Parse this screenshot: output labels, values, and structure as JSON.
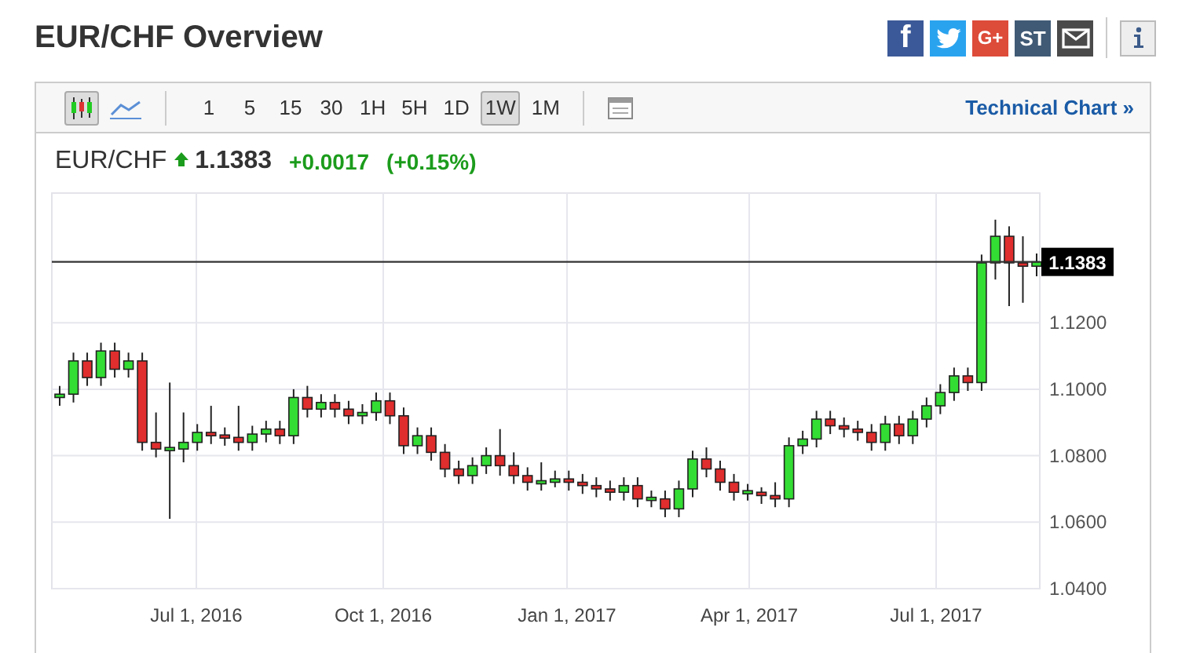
{
  "page": {
    "title": "EUR/CHF Overview"
  },
  "share_buttons": [
    {
      "kind": "facebook",
      "text": "f"
    },
    {
      "kind": "twitter"
    },
    {
      "kind": "googleplus",
      "text": "G+"
    },
    {
      "kind": "stocktwits",
      "text": "ST"
    },
    {
      "kind": "email"
    }
  ],
  "toolbar": {
    "chart_types": [
      {
        "kind": "candlestick",
        "selected": true
      },
      {
        "kind": "line",
        "selected": false
      }
    ],
    "intervals": [
      {
        "label": "1",
        "selected": false
      },
      {
        "label": "5",
        "selected": false
      },
      {
        "label": "15",
        "selected": false
      },
      {
        "label": "30",
        "selected": false
      },
      {
        "label": "1H",
        "selected": false
      },
      {
        "label": "5H",
        "selected": false
      },
      {
        "label": "1D",
        "selected": false
      },
      {
        "label": "1W",
        "selected": true
      },
      {
        "label": "1M",
        "selected": false
      }
    ],
    "technical_link": "Technical Chart »"
  },
  "quote": {
    "symbol": "EUR/CHF",
    "trend_up": true,
    "price": "1.1383",
    "change": "+0.0017",
    "change_percent": "(+0.15%)"
  },
  "chart": {
    "x_labels": [
      "Jul 1, 2016",
      "Oct 1, 2016",
      "Jan 1, 2017",
      "Apr 1, 2017",
      "Jul 1, 2017"
    ],
    "chart_data": {
      "type": "candlestick",
      "ylim": [
        1.04,
        1.159
      ],
      "grid": true,
      "ref_lines": [
        {
          "axis": "y",
          "value": 1.1383,
          "label": "1.1383"
        }
      ],
      "yticks": [
        {
          "value": 1.12,
          "label": "1.1200"
        },
        {
          "value": 1.1,
          "label": "1.1000"
        },
        {
          "value": 1.08,
          "label": "1.0800"
        },
        {
          "value": 1.06,
          "label": "1.0600"
        },
        {
          "value": 1.04,
          "label": "1.0400"
        }
      ],
      "ohlc": [
        [
          1.0975,
          1.101,
          1.095,
          1.0985
        ],
        [
          1.0985,
          1.111,
          1.096,
          1.1085
        ],
        [
          1.1085,
          1.111,
          1.101,
          1.1035
        ],
        [
          1.1035,
          1.114,
          1.101,
          1.1115
        ],
        [
          1.1115,
          1.114,
          1.1035,
          1.106
        ],
        [
          1.106,
          1.111,
          1.1035,
          1.1085
        ],
        [
          1.1085,
          1.111,
          1.0815,
          1.084
        ],
        [
          1.084,
          1.093,
          1.0795,
          1.082
        ],
        [
          1.082,
          1.102,
          1.061,
          1.082
        ],
        [
          1.082,
          1.093,
          1.078,
          1.084
        ],
        [
          1.084,
          1.0895,
          1.0815,
          1.087
        ],
        [
          1.087,
          1.095,
          1.0835,
          1.086
        ],
        [
          1.086,
          1.0885,
          1.083,
          1.0855
        ],
        [
          1.0855,
          1.095,
          1.0815,
          1.084
        ],
        [
          1.084,
          1.089,
          1.0815,
          1.0865
        ],
        [
          1.0865,
          1.0905,
          1.084,
          1.088
        ],
        [
          1.088,
          1.0905,
          1.0835,
          1.086
        ],
        [
          1.086,
          1.1,
          1.0835,
          1.0975
        ],
        [
          1.0975,
          1.101,
          1.0915,
          1.094
        ],
        [
          1.094,
          1.0985,
          1.0915,
          1.096
        ],
        [
          1.096,
          1.0985,
          1.0915,
          1.094
        ],
        [
          1.094,
          1.0965,
          1.0895,
          1.092
        ],
        [
          1.092,
          1.0955,
          1.0895,
          1.093
        ],
        [
          1.093,
          1.099,
          1.0905,
          1.0965
        ],
        [
          1.0965,
          1.099,
          1.0895,
          1.092
        ],
        [
          1.092,
          1.0945,
          1.0805,
          1.083
        ],
        [
          1.083,
          1.0885,
          1.0805,
          1.086
        ],
        [
          1.086,
          1.0885,
          1.0785,
          1.081
        ],
        [
          1.081,
          1.0835,
          1.0735,
          1.076
        ],
        [
          1.076,
          1.0785,
          1.0715,
          1.074
        ],
        [
          1.074,
          1.0795,
          1.0715,
          1.077
        ],
        [
          1.077,
          1.0825,
          1.0745,
          1.08
        ],
        [
          1.08,
          1.088,
          1.074,
          1.077
        ],
        [
          1.077,
          1.081,
          1.0715,
          1.074
        ],
        [
          1.074,
          1.0765,
          1.0695,
          1.072
        ],
        [
          1.072,
          1.078,
          1.0695,
          1.072
        ],
        [
          1.072,
          1.0755,
          1.0705,
          1.073
        ],
        [
          1.073,
          1.0755,
          1.0695,
          1.072
        ],
        [
          1.072,
          1.0745,
          1.0685,
          1.071
        ],
        [
          1.071,
          1.0735,
          1.0675,
          1.07
        ],
        [
          1.07,
          1.0725,
          1.0665,
          1.069
        ],
        [
          1.069,
          1.0735,
          1.0665,
          1.071
        ],
        [
          1.071,
          1.0735,
          1.0645,
          1.067
        ],
        [
          1.067,
          1.0695,
          1.0645,
          1.067
        ],
        [
          1.067,
          1.0695,
          1.0615,
          1.064
        ],
        [
          1.064,
          1.0725,
          1.0615,
          1.07
        ],
        [
          1.07,
          1.0815,
          1.0675,
          1.079
        ],
        [
          1.079,
          1.0825,
          1.0735,
          1.076
        ],
        [
          1.076,
          1.0785,
          1.0695,
          1.072
        ],
        [
          1.072,
          1.0745,
          1.0665,
          1.069
        ],
        [
          1.069,
          1.0715,
          1.0665,
          1.069
        ],
        [
          1.069,
          1.0705,
          1.0655,
          1.068
        ],
        [
          1.068,
          1.072,
          1.0645,
          1.067
        ],
        [
          1.067,
          1.0855,
          1.0645,
          1.083
        ],
        [
          1.083,
          1.0875,
          1.0805,
          1.085
        ],
        [
          1.085,
          1.0935,
          1.0825,
          1.091
        ],
        [
          1.091,
          1.0935,
          1.0865,
          1.089
        ],
        [
          1.089,
          1.0915,
          1.0855,
          1.088
        ],
        [
          1.088,
          1.0905,
          1.0845,
          1.087
        ],
        [
          1.087,
          1.0895,
          1.0815,
          1.084
        ],
        [
          1.084,
          1.092,
          1.0815,
          1.0895
        ],
        [
          1.0895,
          1.092,
          1.0835,
          1.086
        ],
        [
          1.086,
          1.0935,
          1.0835,
          1.091
        ],
        [
          1.091,
          1.0975,
          1.0885,
          1.095
        ],
        [
          1.095,
          1.1015,
          1.0925,
          1.099
        ],
        [
          1.099,
          1.1065,
          1.0965,
          1.104
        ],
        [
          1.104,
          1.1065,
          1.0995,
          1.102
        ],
        [
          1.102,
          1.1405,
          1.0995,
          1.138
        ],
        [
          1.138,
          1.151,
          1.133,
          1.146
        ],
        [
          1.146,
          1.149,
          1.125,
          1.138
        ],
        [
          1.138,
          1.146,
          1.126,
          1.137
        ],
        [
          1.137,
          1.1408,
          1.134,
          1.1383
        ]
      ]
    }
  }
}
